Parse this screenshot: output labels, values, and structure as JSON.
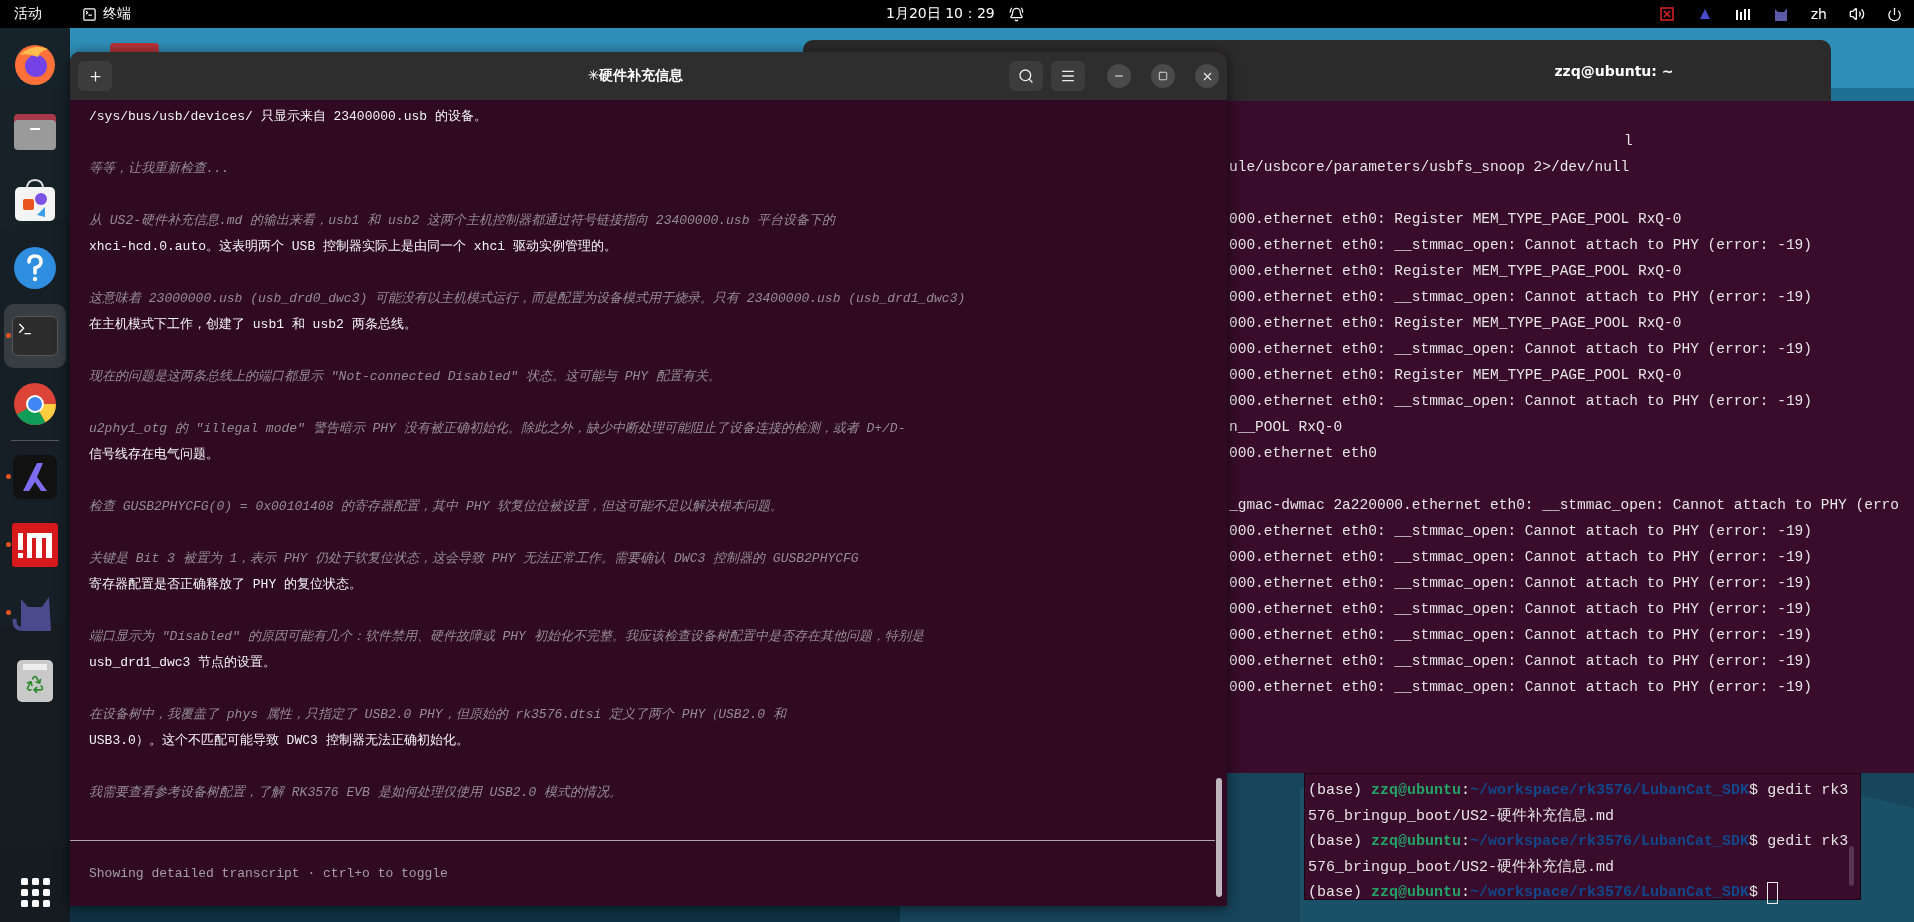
{
  "top_bar": {
    "activities": "活动",
    "app": "终端",
    "clock": "1月20日 10：29",
    "language": "zh"
  },
  "dock": {
    "items": [
      {
        "kind": "firefox",
        "running": false,
        "selected": false
      },
      {
        "kind": "files",
        "running": false,
        "selected": false
      },
      {
        "kind": "store",
        "running": false,
        "selected": false
      },
      {
        "kind": "help",
        "running": false,
        "selected": false
      },
      {
        "kind": "terminal",
        "running": true,
        "selected": true
      },
      {
        "kind": "chrome",
        "running": false,
        "selected": false
      },
      {
        "kind": "separator"
      },
      {
        "kind": "a-app",
        "running": true,
        "selected": false
      },
      {
        "kind": "m-app",
        "running": true,
        "selected": false
      },
      {
        "kind": "cat",
        "running": true,
        "selected": false
      },
      {
        "kind": "trash",
        "running": false,
        "selected": false
      }
    ]
  },
  "front_window": {
    "title": "✳硬件补充信息",
    "paragraphs": [
      [
        {
          "text": "/sys/bus/usb/devices/ 只显示来自 23400000.usb 的设备。",
          "dim": false
        }
      ],
      [
        {
          "text": "等等，让我重新检查...",
          "dim": true
        }
      ],
      [
        {
          "text": "从 US2-硬件补充信息.md 的输出来看，usb1 和 usb2 这两个主机控制器都通过符号链接指向 23400000.usb 平台设备下的",
          "dim": true
        },
        {
          "text": "xhci-hcd.0.auto。这表明两个 USB 控制器实际上是由同一个 xhci 驱动实例管理的。",
          "dim": false
        }
      ],
      [
        {
          "text": "这意味着 23000000.usb (usb_drd0_dwc3) 可能没有以主机模式运行，而是配置为设备模式用于烧录。只有 23400000.usb (usb_drd1_dwc3)",
          "dim": true
        },
        {
          "text": "在主机模式下工作，创建了 usb1 和 usb2 两条总线。",
          "dim": false
        }
      ],
      [
        {
          "text": "现在的问题是这两条总线上的端口都显示 \"Not-connected Disabled\" 状态。这可能与 PHY 配置有关。",
          "dim": true
        }
      ],
      [
        {
          "text": "u2phy1_otg 的 \"illegal mode\" 警告暗示 PHY 没有被正确初始化。除此之外，缺少中断处理可能阻止了设备连接的检测，或者 D+/D-",
          "dim": true
        },
        {
          "text": "信号线存在电气问题。",
          "dim": false
        }
      ],
      [
        {
          "text": "检查 GUSB2PHYCFG(0) = 0x00101408 的寄存器配置，其中 PHY 软复位位被设置，但这可能不足以解决根本问题。",
          "dim": true
        }
      ],
      [
        {
          "text": "关键是 Bit 3 被置为 1，表示 PHY 仍处于软复位状态，这会导致 PHY 无法正常工作。需要确认 DWC3 控制器的 GUSB2PHYCFG",
          "dim": true
        },
        {
          "text": "寄存器配置是否正确释放了 PHY 的复位状态。",
          "dim": false
        }
      ],
      [
        {
          "text": "端口显示为 \"Disabled\" 的原因可能有几个：软件禁用、硬件故障或 PHY 初始化不完整。我应该检查设备树配置中是否存在其他问题，特别是",
          "dim": true
        },
        {
          "text": "usb_drd1_dwc3 节点的设置。",
          "dim": false
        }
      ],
      [
        {
          "text": "在设备树中，我覆盖了 phys 属性，只指定了 USB2.0 PHY，但原始的 rk3576.dtsi 定义了两个 PHY（USB2.0 和",
          "dim": true
        },
        {
          "text": "USB3.0）。这个不匹配可能导致 DWC3 控制器无法正确初始化。",
          "dim": false
        }
      ],
      [
        {
          "text": "我需要查看参考设备树配置，了解 RK3576 EVB 是如何处理仅使用 USB2.0 模式的情况。",
          "dim": true
        }
      ]
    ],
    "footer": "Showing detailed transcript · ctrl+o to toggle"
  },
  "back_window": {
    "title": "zzq@ubuntu: ~",
    "lines": [
      {
        "kind": "tail",
        "text": "l"
      },
      {
        "kind": "line",
        "text": "ule/usbcore/parameters/usbfs_snoop 2>/dev/null"
      },
      {
        "kind": "blank"
      },
      {
        "kind": "line",
        "text": "000.ethernet eth0: Register MEM_TYPE_PAGE_POOL RxQ-0"
      },
      {
        "kind": "line",
        "text": "000.ethernet eth0: __stmmac_open: Cannot attach to PHY (error: -19)"
      },
      {
        "kind": "line",
        "text": "000.ethernet eth0: Register MEM_TYPE_PAGE_POOL RxQ-0"
      },
      {
        "kind": "line",
        "text": "000.ethernet eth0: __stmmac_open: Cannot attach to PHY (error: -19)"
      },
      {
        "kind": "line",
        "text": "000.ethernet eth0: Register MEM_TYPE_PAGE_POOL RxQ-0"
      },
      {
        "kind": "line",
        "text": "000.ethernet eth0: __stmmac_open: Cannot attach to PHY (error: -19)"
      },
      {
        "kind": "line",
        "text": "000.ethernet eth0: Register MEM_TYPE_PAGE_POOL RxQ-0"
      },
      {
        "kind": "line",
        "text": "000.ethernet eth0: __stmmac_open: Cannot attach to PHY (error: -19)"
      },
      {
        "kind": "line",
        "text": "n__POOL RxQ-0"
      },
      {
        "kind": "line",
        "text": "000.ethernet eth0"
      },
      {
        "kind": "blank"
      },
      {
        "kind": "line",
        "text": "_gmac-dwmac 2a220000.ethernet eth0: __stmmac_open: Cannot attach to PHY (erro"
      },
      {
        "kind": "line",
        "text": "000.ethernet eth0: __stmmac_open: Cannot attach to PHY (error: -19)"
      },
      {
        "kind": "line",
        "text": "000.ethernet eth0: __stmmac_open: Cannot attach to PHY (error: -19)"
      },
      {
        "kind": "line",
        "text": "000.ethernet eth0: __stmmac_open: Cannot attach to PHY (error: -19)"
      },
      {
        "kind": "line",
        "text": "000.ethernet eth0: __stmmac_open: Cannot attach to PHY (error: -19)"
      },
      {
        "kind": "line",
        "text": "000.ethernet eth0: __stmmac_open: Cannot attach to PHY (error: -19)"
      },
      {
        "kind": "line",
        "text": "000.ethernet eth0: __stmmac_open: Cannot attach to PHY (error: -19)"
      },
      {
        "kind": "line",
        "text": "000.ethernet eth0: __stmmac_open: Cannot attach to PHY (error: -19)"
      }
    ]
  },
  "small_terminal": {
    "lines": [
      {
        "kind": "prompt",
        "env": "(base)",
        "user": "zzq@ubuntu",
        "sep": ":",
        "path": "~/workspace/rk3576/LubanCat_SDK",
        "sign": "$",
        "command": "gedit rk3",
        "cursor": false
      },
      {
        "kind": "output",
        "text": "576_bringup_boot/US2-硬件补充信息.md"
      },
      {
        "kind": "prompt",
        "env": "(base)",
        "user": "zzq@ubuntu",
        "sep": ":",
        "path": "~/workspace/rk3576/LubanCat_SDK",
        "sign": "$",
        "command": "gedit rk3",
        "cursor": false
      },
      {
        "kind": "output",
        "text": "576_bringup_boot/US2-硬件补充信息.md"
      },
      {
        "kind": "prompt",
        "env": "(base)",
        "user": "zzq@ubuntu",
        "sep": ":",
        "path": "~/workspace/rk3576/LubanCat_SDK",
        "sign": "$",
        "cursor": true
      }
    ]
  }
}
